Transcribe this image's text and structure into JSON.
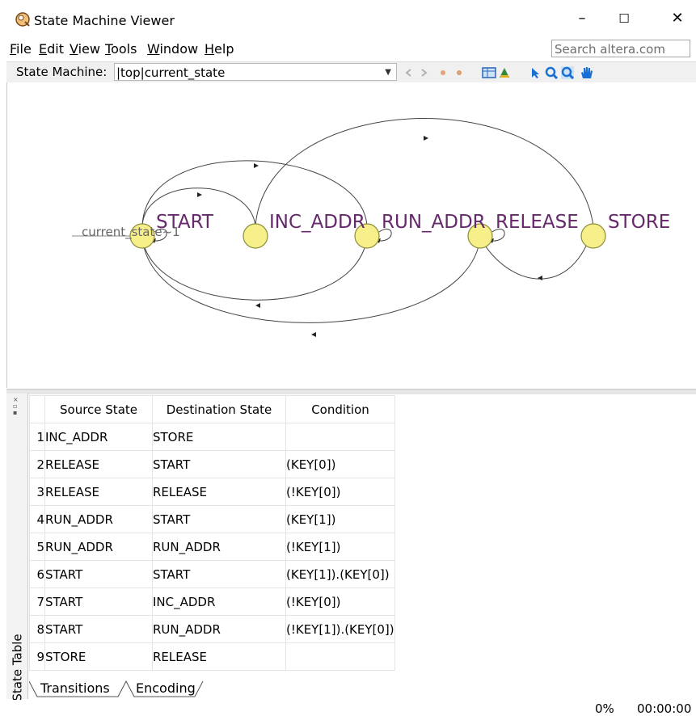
{
  "window": {
    "title": "State Machine Viewer",
    "minimize": "–",
    "maximize": "☐",
    "close": "✕"
  },
  "menu": {
    "file": {
      "u": "F",
      "rest": "ile"
    },
    "edit": {
      "u": "E",
      "rest": "dit"
    },
    "view": {
      "u": "V",
      "rest": "iew"
    },
    "tools": {
      "u": "T",
      "rest": "ools"
    },
    "window": {
      "u": "W",
      "rest": "indow"
    },
    "help": {
      "u": "H",
      "rest": "elp"
    }
  },
  "search": {
    "placeholder": "Search altera.com"
  },
  "toolbar": {
    "label": "State Machine:",
    "selected": "|top|current_state"
  },
  "diagram": {
    "input_label": "current_state~1",
    "states": [
      "START",
      "INC_ADDR",
      "RUN_ADDR",
      "RELEASE",
      "STORE"
    ],
    "colors": {
      "state_fill": "#f7f08a",
      "state_stroke": "#8c8c3a",
      "label": "#66296b"
    }
  },
  "side_panel": {
    "label": "State Table"
  },
  "table": {
    "headers": [
      "Source State",
      "Destination State",
      "Condition"
    ],
    "rows": [
      {
        "n": "1",
        "src": "INC_ADDR",
        "dst": "STORE",
        "cond": ""
      },
      {
        "n": "2",
        "src": "RELEASE",
        "dst": "START",
        "cond": "(KEY[0])"
      },
      {
        "n": "3",
        "src": "RELEASE",
        "dst": "RELEASE",
        "cond": "(!KEY[0])"
      },
      {
        "n": "4",
        "src": "RUN_ADDR",
        "dst": "START",
        "cond": "(KEY[1])"
      },
      {
        "n": "5",
        "src": "RUN_ADDR",
        "dst": "RUN_ADDR",
        "cond": "(!KEY[1])"
      },
      {
        "n": "6",
        "src": "START",
        "dst": "START",
        "cond": "(KEY[1]).(KEY[0])"
      },
      {
        "n": "7",
        "src": "START",
        "dst": "INC_ADDR",
        "cond": "(!KEY[0])"
      },
      {
        "n": "8",
        "src": "START",
        "dst": "RUN_ADDR",
        "cond": "(!KEY[1]).(KEY[0])"
      },
      {
        "n": "9",
        "src": "STORE",
        "dst": "RELEASE",
        "cond": ""
      }
    ]
  },
  "tabs": [
    "Transitions",
    "Encoding"
  ],
  "status": {
    "progress": "0%",
    "time": "00:00:00"
  }
}
